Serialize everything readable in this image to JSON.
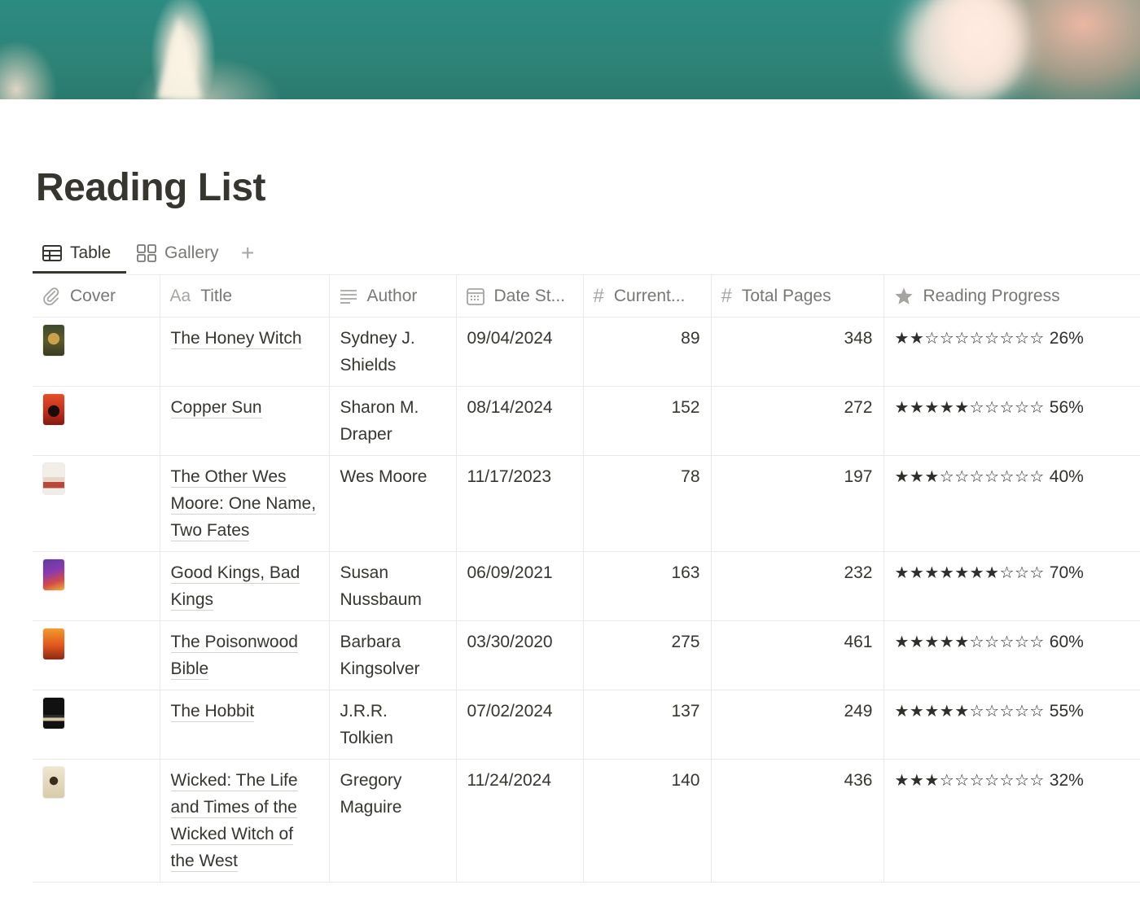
{
  "page": {
    "title": "Reading List"
  },
  "views": {
    "tabs": [
      {
        "label": "Table",
        "icon": "table-icon",
        "active": true
      },
      {
        "label": "Gallery",
        "icon": "gallery-icon",
        "active": false
      }
    ],
    "add_view_label": "+"
  },
  "table": {
    "columns": [
      {
        "label": "Cover",
        "icon": "paperclip-icon"
      },
      {
        "label": "Title",
        "icon": "text-aa-icon",
        "icon_text": "Aa"
      },
      {
        "label": "Author",
        "icon": "lines-icon"
      },
      {
        "label": "Date St...",
        "icon": "calendar-icon"
      },
      {
        "label": "Current...",
        "icon": "hash-icon",
        "icon_text": "#"
      },
      {
        "label": "Total Pages",
        "icon": "hash-icon",
        "icon_text": "#"
      },
      {
        "label": "Reading Progress",
        "icon": "star-icon"
      }
    ],
    "rows": [
      {
        "cover": "honey-witch-cover",
        "title": "The Honey Witch",
        "author": "Sydney J. Shields",
        "date_started": "09/04/2024",
        "current_page": "89",
        "total_pages": "348",
        "progress_stars_filled": 2,
        "progress_stars_total": 10,
        "progress_percent": "26%"
      },
      {
        "cover": "copper-sun-cover",
        "title": "Copper Sun",
        "author": "Sharon M. Draper",
        "date_started": "08/14/2024",
        "current_page": "152",
        "total_pages": "272",
        "progress_stars_filled": 5,
        "progress_stars_total": 10,
        "progress_percent": "56%"
      },
      {
        "cover": "other-wes-moore-cover",
        "title": "The Other Wes Moore: One Name, Two Fates",
        "author": "Wes Moore",
        "date_started": "11/17/2023",
        "current_page": "78",
        "total_pages": "197",
        "progress_stars_filled": 3,
        "progress_stars_total": 10,
        "progress_percent": "40%"
      },
      {
        "cover": "good-kings-cover",
        "title": "Good Kings, Bad Kings",
        "author": "Susan Nussbaum",
        "date_started": "06/09/2021",
        "current_page": "163",
        "total_pages": "232",
        "progress_stars_filled": 7,
        "progress_stars_total": 10,
        "progress_percent": "70%"
      },
      {
        "cover": "poisonwood-cover",
        "title": "The Poisonwood Bible",
        "author": "Barbara Kingsolver",
        "date_started": "03/30/2020",
        "current_page": "275",
        "total_pages": "461",
        "progress_stars_filled": 5,
        "progress_stars_total": 10,
        "progress_percent": "60%"
      },
      {
        "cover": "hobbit-cover",
        "title": "The Hobbit",
        "author": "J.R.R. Tolkien",
        "date_started": "07/02/2024",
        "current_page": "137",
        "total_pages": "249",
        "progress_stars_filled": 5,
        "progress_stars_total": 10,
        "progress_percent": "55%"
      },
      {
        "cover": "wicked-cover",
        "title": "Wicked: The Life and Times of the Wicked Witch of the West",
        "author": "Gregory Maguire",
        "date_started": "11/24/2024",
        "current_page": "140",
        "total_pages": "436",
        "progress_stars_filled": 3,
        "progress_stars_total": 10,
        "progress_percent": "32%"
      }
    ]
  },
  "colors": {
    "text": "#37352f",
    "muted": "#787774",
    "border": "#e9e9e7",
    "cover_teal": "#2b8c83"
  }
}
